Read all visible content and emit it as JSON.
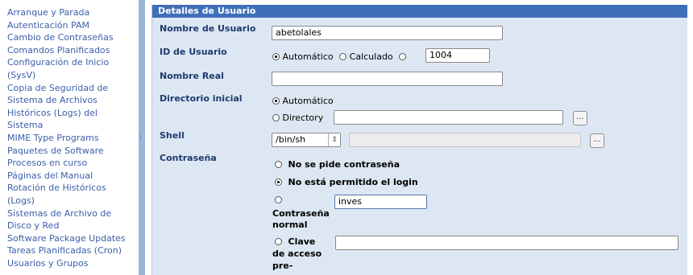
{
  "sidebar": {
    "items": [
      "Arranque y Parada",
      "Autenticación PAM",
      "Cambio de Contraseñas",
      "Comandos Planificados",
      "Configuración de Inicio",
      "(SysV)",
      "Copia de Seguridad de",
      "Sistema de Archivos",
      "Históricos (Logs) del",
      "Sistema",
      "MIME Type Programs",
      "Paquetes de Software",
      "Procesos en curso",
      "Páginas del Manual",
      "Rotación de Históricos",
      "(Logs)",
      "Sistemas de Archivo de",
      "Disco y Red",
      "Software Package Updates",
      "Tareas Planificadas (Cron)",
      "Usuarios y Grupos"
    ]
  },
  "panel": {
    "title": "Detalles de Usuario",
    "username_label": "Nombre de Usuario",
    "username_value": "abetolales",
    "uid_label": "ID de Usuario",
    "uid_auto": "Automático",
    "uid_calc": "Calculado",
    "uid_value": "1004",
    "realname_label": "Nombre Real",
    "realname_value": "",
    "homedir_label": "Directorio inicial",
    "homedir_auto": "Automático",
    "homedir_dir": "Directory",
    "browse": "...",
    "shell_label": "Shell",
    "shell_value": "/bin/sh",
    "password_label": "Contraseña",
    "pw_none": "No se pide contraseña",
    "pw_nologin": "No está permitido el login",
    "pw_normal_1": "Contraseña",
    "pw_normal_2": "normal",
    "pw_normal_value": "inves",
    "pw_pre_1": "Clave",
    "pw_pre_2": "de acceso",
    "pw_pre_3": "pre-"
  }
}
